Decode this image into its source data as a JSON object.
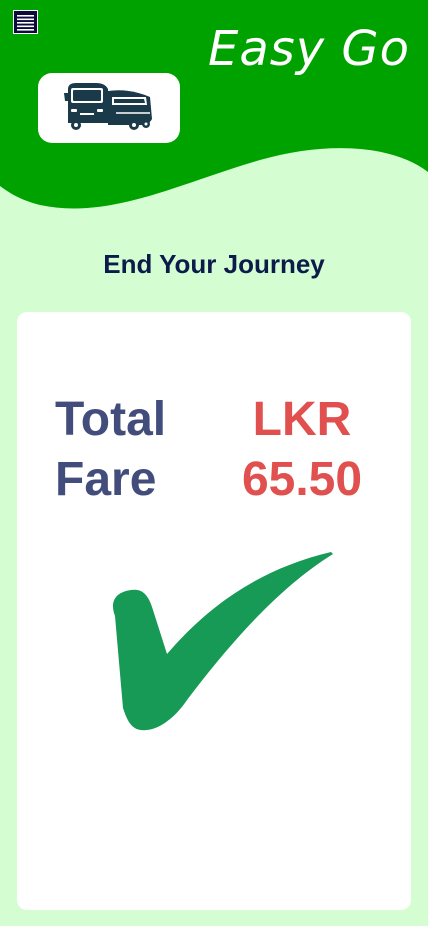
{
  "app": {
    "title": "Easy Go",
    "logo_icon": "bus-icon",
    "menu_icon": "hamburger-menu-icon"
  },
  "page": {
    "heading": "End Your Journey"
  },
  "fare": {
    "label": "Total Fare",
    "amount": "LKR 65.50",
    "status_icon": "check-mark-icon"
  },
  "colors": {
    "header_green": "#00a200",
    "background_mint": "#d4fdd2",
    "heading_navy": "#0d1b4a",
    "label_slate": "#434d7b",
    "amount_red": "#e0504f",
    "check_green": "#169a55"
  }
}
